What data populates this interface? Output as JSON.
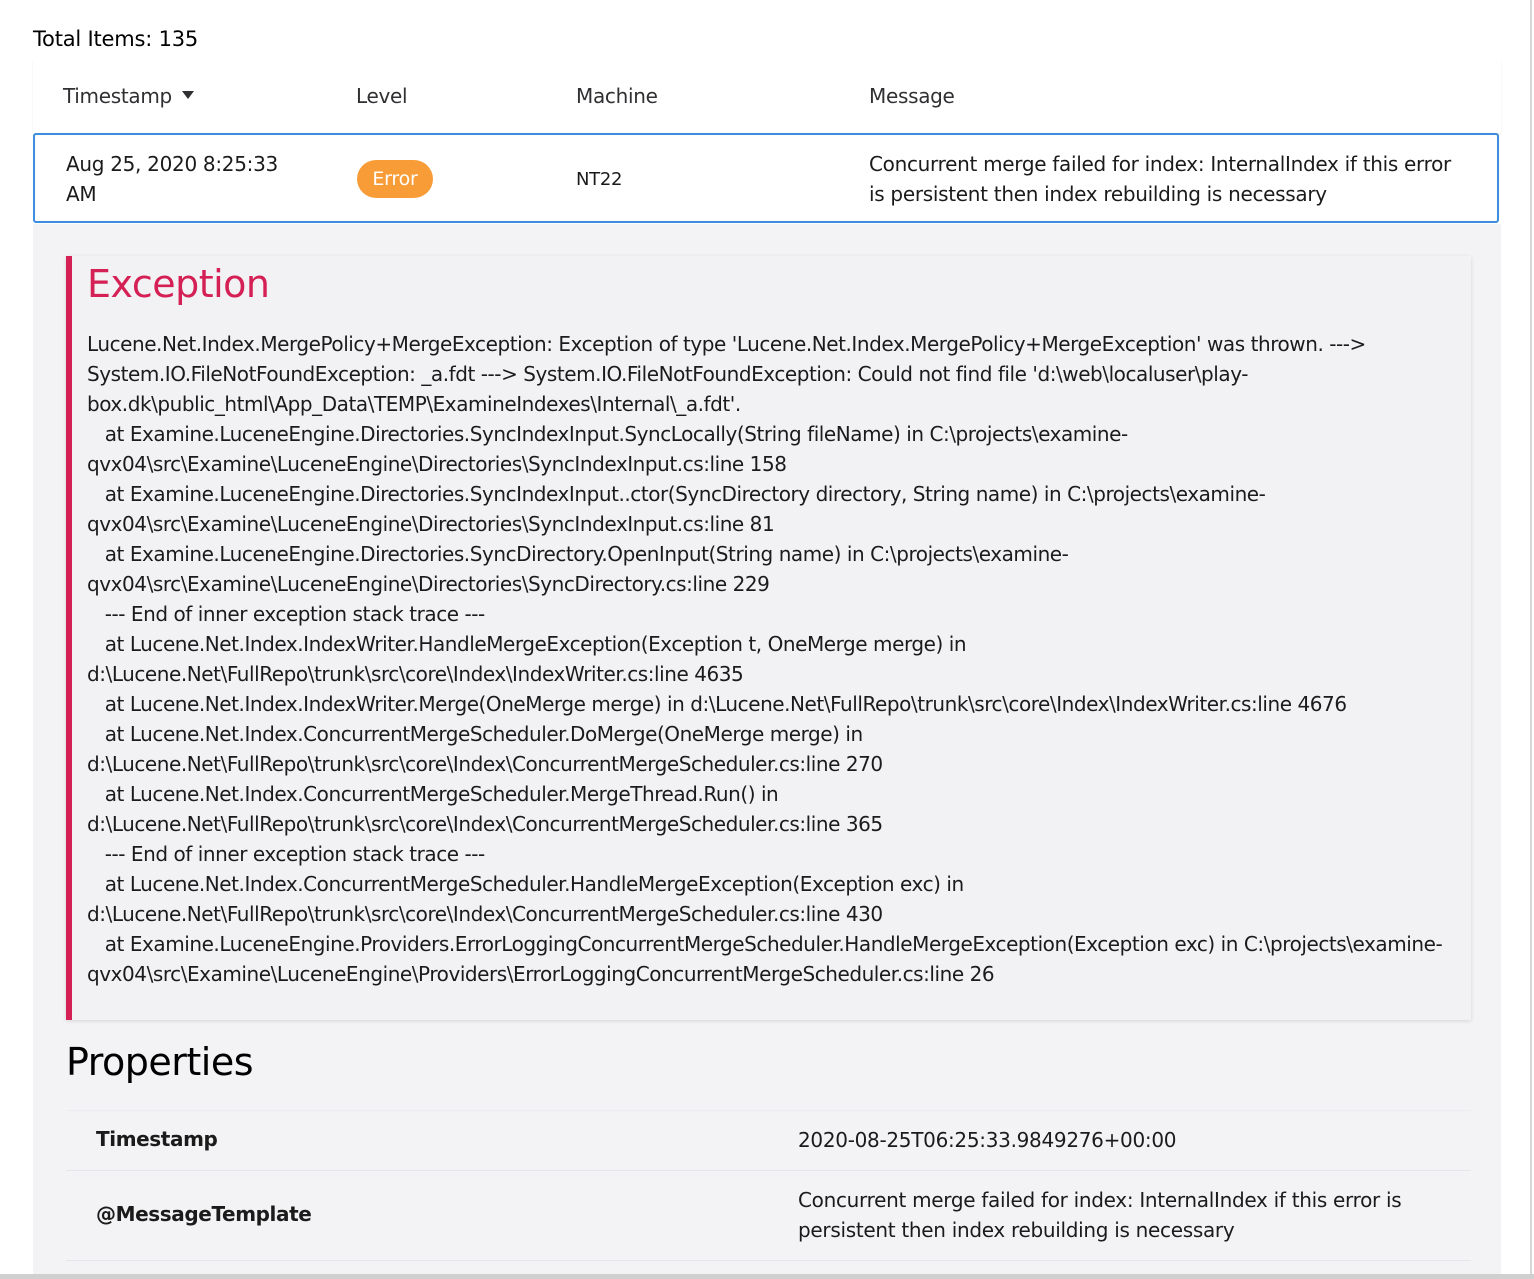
{
  "summary": {
    "total_items": "Total Items: 135"
  },
  "table": {
    "columns": {
      "timestamp": "Timestamp",
      "level": "Level",
      "machine": "Machine",
      "message": "Message"
    },
    "sort_icon": "caret-down-icon",
    "row": {
      "timestamp_line1": "Aug 25, 2020 8:25:33",
      "timestamp_line2": "AM",
      "level": "Error",
      "machine": "NT22",
      "message": "Concurrent merge failed for index: InternalIndex if this error is persistent then index rebuilding is necessary"
    }
  },
  "exception": {
    "title": "Exception",
    "text": "Lucene.Net.Index.MergePolicy+MergeException: Exception of type 'Lucene.Net.Index.MergePolicy+MergeException' was thrown. --->\nSystem.IO.FileNotFoundException: _a.fdt ---> System.IO.FileNotFoundException: Could not find file 'd:\\web\\localuser\\play-\nbox.dk\\public_html\\App_Data\\TEMP\\ExamineIndexes\\Internal\\_a.fdt'.\n   at Examine.LuceneEngine.Directories.SyncIndexInput.SyncLocally(String fileName) in C:\\projects\\examine-\nqvx04\\src\\Examine\\LuceneEngine\\Directories\\SyncIndexInput.cs:line 158\n   at Examine.LuceneEngine.Directories.SyncIndexInput..ctor(SyncDirectory directory, String name) in C:\\projects\\examine-\nqvx04\\src\\Examine\\LuceneEngine\\Directories\\SyncIndexInput.cs:line 81\n   at Examine.LuceneEngine.Directories.SyncDirectory.OpenInput(String name) in C:\\projects\\examine-\nqvx04\\src\\Examine\\LuceneEngine\\Directories\\SyncDirectory.cs:line 229\n   --- End of inner exception stack trace ---\n   at Lucene.Net.Index.IndexWriter.HandleMergeException(Exception t, OneMerge merge) in\nd:\\Lucene.Net\\FullRepo\\trunk\\src\\core\\Index\\IndexWriter.cs:line 4635\n   at Lucene.Net.Index.IndexWriter.Merge(OneMerge merge) in d:\\Lucene.Net\\FullRepo\\trunk\\src\\core\\Index\\IndexWriter.cs:line 4676\n   at Lucene.Net.Index.ConcurrentMergeScheduler.DoMerge(OneMerge merge) in\nd:\\Lucene.Net\\FullRepo\\trunk\\src\\core\\Index\\ConcurrentMergeScheduler.cs:line 270\n   at Lucene.Net.Index.ConcurrentMergeScheduler.MergeThread.Run() in\nd:\\Lucene.Net\\FullRepo\\trunk\\src\\core\\Index\\ConcurrentMergeScheduler.cs:line 365\n   --- End of inner exception stack trace ---\n   at Lucene.Net.Index.ConcurrentMergeScheduler.HandleMergeException(Exception exc) in\nd:\\Lucene.Net\\FullRepo\\trunk\\src\\core\\Index\\ConcurrentMergeScheduler.cs:line 430\n   at Examine.LuceneEngine.Providers.ErrorLoggingConcurrentMergeScheduler.HandleMergeException(Exception exc) in C:\\projects\\examine-\nqvx04\\src\\Examine\\LuceneEngine\\Providers\\ErrorLoggingConcurrentMergeScheduler.cs:line 26"
  },
  "properties": {
    "title": "Properties",
    "rows": [
      {
        "key": "Timestamp",
        "value": "2020-08-25T06:25:33.9849276+00:00"
      },
      {
        "key": "@MessageTemplate",
        "value": "Concurrent merge failed for index: InternalIndex if this error is persistent then index rebuilding is necessary"
      }
    ]
  },
  "colors": {
    "accent_border": "#3e8ee0",
    "error_badge": "#f79c37",
    "exception_red": "#d42054",
    "panel_bg": "#f3f3f5"
  }
}
